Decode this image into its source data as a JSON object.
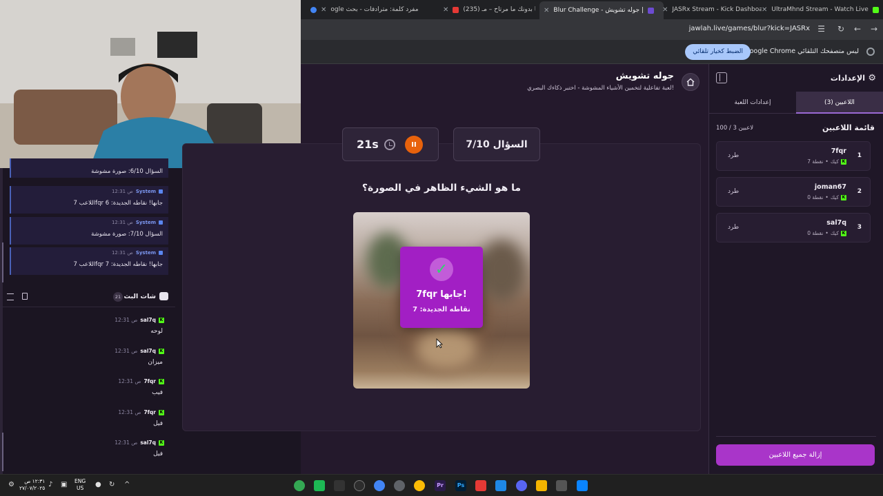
{
  "browser": {
    "tabs": [
      {
        "title": "ogle مفرد كلمة: مترادفات - بحث",
        "active": false
      },
      {
        "title": "(235) أنا بدونك ما مرتاح – مـ",
        "active": false
      },
      {
        "title": "Blur Challenge - جوله تشويش |",
        "active": true
      },
      {
        "title": "JASRx Stream - Kick Dashboard",
        "active": false
      },
      {
        "title": "UltraMhnd Stream - Watch Live",
        "active": false
      }
    ],
    "url": "jawlah.live/games/blur?kick=JASRx",
    "infobar_text": "Google Chrome ليس متصفحك التلقائي",
    "infobar_button": "الضبط كخيار تلقائي"
  },
  "game": {
    "title": "جوله تشويش",
    "subtitle": "لعبة تفاعلية لتخمين الأشياء المشوشة - اختبر ذكاءك البصري!",
    "timer": "21s",
    "question_counter": "السؤال 7/10",
    "question": "ما هو الشيء الظاهر في الصورة؟",
    "correct_title": "7fqr جابها!",
    "correct_points": "نقاطه الجديدة: 7"
  },
  "sidebar": {
    "title": "الإعدادات",
    "tabs": {
      "players": "اللاعبين (3)",
      "game_settings": "إعدادات اللعبة"
    },
    "players_heading": "قائمة اللاعبين",
    "players_count": "100 / 3 لاعبين",
    "players": [
      {
        "rank": "1",
        "name": "7fqr",
        "platform": "كيك",
        "points": "7 نقطة",
        "kick": "طرد"
      },
      {
        "rank": "2",
        "name": "joman67",
        "platform": "كيك",
        "points": "0 نقطة",
        "kick": "طرد"
      },
      {
        "rank": "3",
        "name": "sal7q",
        "platform": "كيك",
        "points": "0 نقطة",
        "kick": "طرد"
      }
    ],
    "remove_all": "إزالة جميع اللاعبين"
  },
  "system_messages": [
    {
      "name": "",
      "time": "",
      "body": "السؤال 6/10: صورة مشوشة"
    },
    {
      "name": "System",
      "time": "12:31 ص",
      "body": "اللاعب 7fqr جابها! نقاطه الجديدة: 6"
    },
    {
      "name": "System",
      "time": "12:31 ص",
      "body": "السؤال 7/10: صورة مشوشة"
    },
    {
      "name": "System",
      "time": "12:31 ص",
      "body": "اللاعب 7fqr جابها! نقاطه الجديدة: 7"
    }
  ],
  "chat": {
    "title": "شات البث",
    "count": "21",
    "messages": [
      {
        "user": "sal7q",
        "time": "12:31 ص",
        "body": "لوحه"
      },
      {
        "user": "sal7q",
        "time": "12:31 ص",
        "body": "ميزان"
      },
      {
        "user": "7fqr",
        "time": "12:31 ص",
        "body": "فيب"
      },
      {
        "user": "7fqr",
        "time": "12:31 ص",
        "body": "فيل"
      },
      {
        "user": "sal7q",
        "time": "12:31 ص",
        "body": "فيل"
      }
    ]
  },
  "taskbar": {
    "clock_time": "١٢:٣١ ص",
    "clock_date": "٢٧/٠٧/٢٠٢٥",
    "lang_top": "ENG",
    "lang_bottom": "US"
  },
  "colors": {
    "accent_purple": "#a21fc4",
    "timer_orange": "#e8620c",
    "kick_green": "#53fc18",
    "check_green": "#2ed86b"
  }
}
